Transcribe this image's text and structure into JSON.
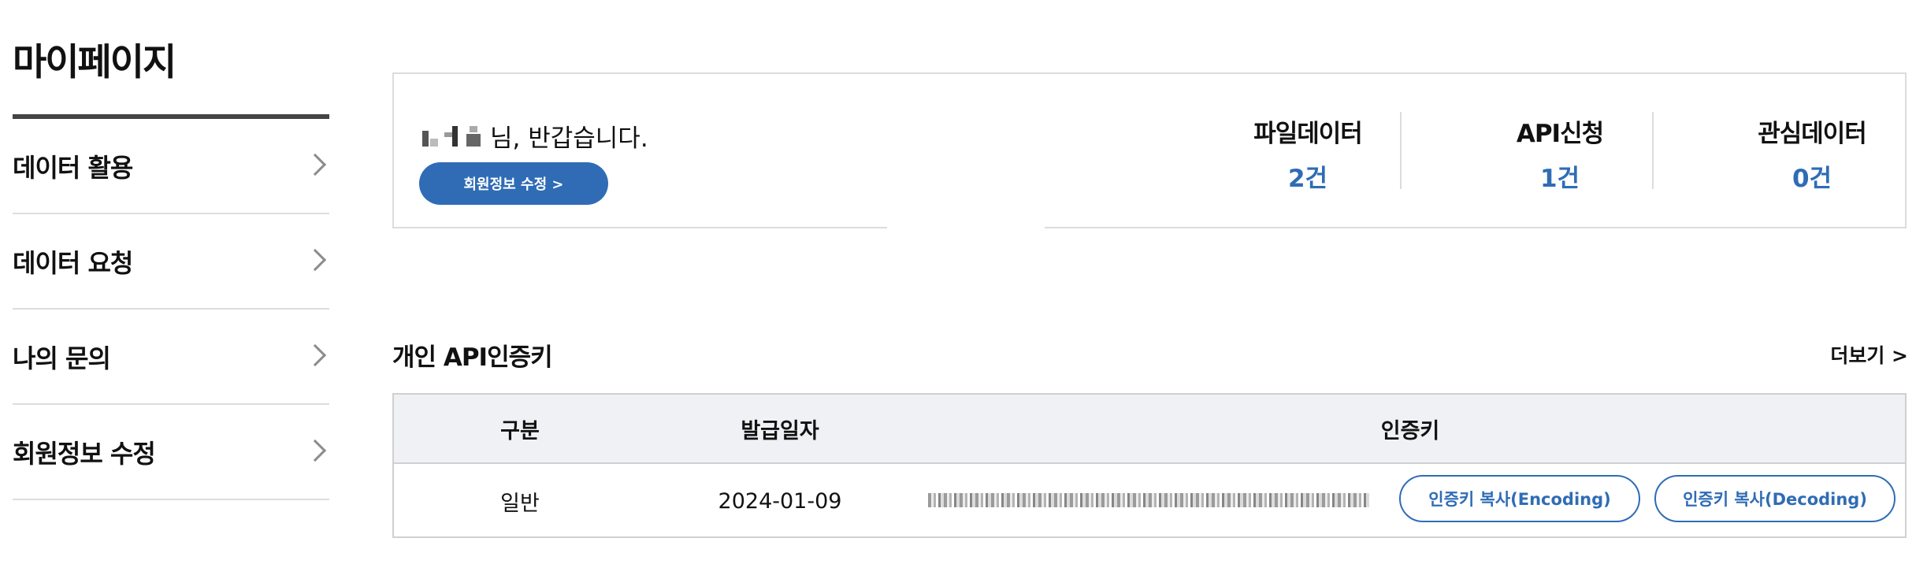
{
  "page_title": "마이페이지",
  "sidebar": {
    "items": [
      {
        "label": "데이터 활용"
      },
      {
        "label": "데이터 요청"
      },
      {
        "label": "나의 문의"
      },
      {
        "label": "회원정보 수정"
      }
    ]
  },
  "profile": {
    "greeting_suffix": "님, 반갑습니다.",
    "edit_button": "회원정보 수정 >",
    "stats": [
      {
        "label": "파일데이터",
        "value": "2건"
      },
      {
        "label": "API신청",
        "value": "1건"
      },
      {
        "label": "관심데이터",
        "value": "0건"
      }
    ]
  },
  "api_keys": {
    "title": "개인 API인증키",
    "more_link": "더보기 >",
    "columns": [
      "구분",
      "발급일자",
      "인증키"
    ],
    "rows": [
      {
        "type": "일반",
        "issued": "2024-01-09"
      }
    ],
    "copy_encoding": "인증키 복사(Encoding)",
    "copy_decoding": "인증키 복사(Decoding)"
  },
  "colors": {
    "accent": "#2f6cb5",
    "header_bg": "#f0f1f4",
    "border": "#dcdcdc"
  }
}
